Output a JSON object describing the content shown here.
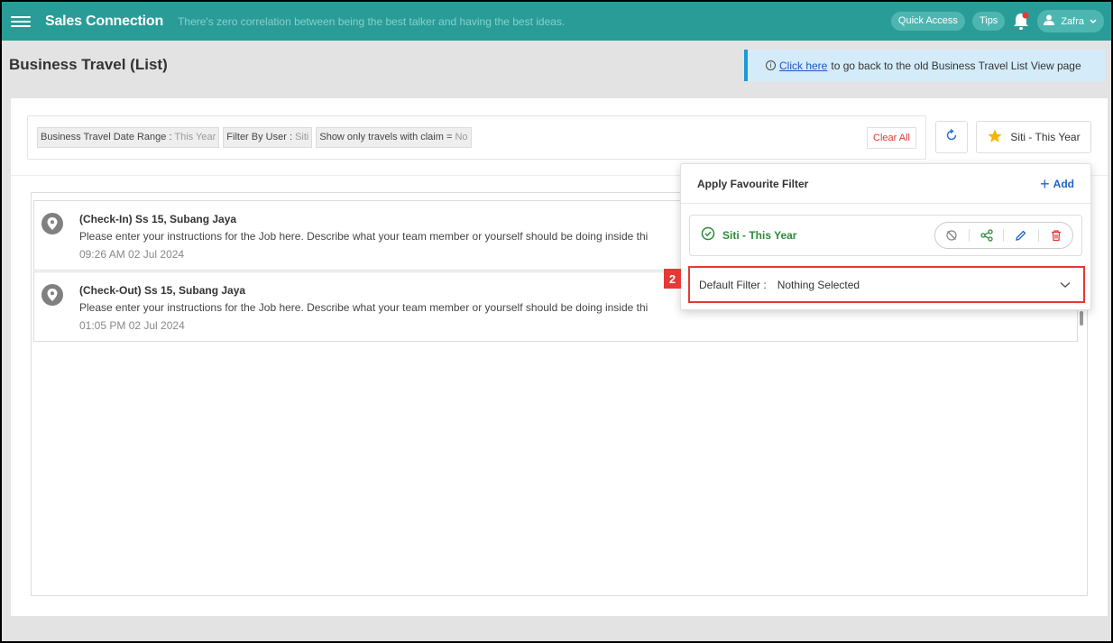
{
  "topbar": {
    "brand": "Sales Connection",
    "tagline": "There's zero correlation between being the best talker and having the best ideas.",
    "quick_access": "Quick Access",
    "tips": "Tips",
    "user_name": "Zafra"
  },
  "page": {
    "title": "Business Travel (List)",
    "notice_link": "Click here",
    "notice_text": "to go back to the old Business Travel List View page"
  },
  "filters": {
    "chips": [
      {
        "label": "Business Travel Date Range",
        "sep": " : ",
        "value": "This Year"
      },
      {
        "label": "Filter By User",
        "sep": " : ",
        "value": "Siti"
      },
      {
        "label": "Show only travels with claim",
        "sep": " = ",
        "value": "No"
      }
    ],
    "clear_all": "Clear All",
    "favourite_button": "Siti - This Year"
  },
  "items": [
    {
      "title": "(Check-In) Ss 15, Subang Jaya",
      "description": "Please enter your instructions for the Job here. Describe what your team member or yourself should be doing inside thi",
      "time": "09:26 AM  02 Jul 2024"
    },
    {
      "title": "(Check-Out) Ss 15, Subang Jaya",
      "description": "Please enter your instructions for the Job here. Describe what your team member or yourself should be doing inside thi",
      "time": "01:05 PM  02 Jul 2024"
    }
  ],
  "favourite_panel": {
    "heading": "Apply Favourite Filter",
    "add_label": "Add",
    "favourite_name": "Siti - This Year",
    "default_filter_label": "Default Filter :",
    "default_filter_value": "Nothing Selected"
  },
  "marker": "2",
  "colors": {
    "topbar": "#2a9c97",
    "accent_blue": "#1e63c8",
    "green": "#2e8b3a",
    "highlight_red": "#e53935"
  }
}
